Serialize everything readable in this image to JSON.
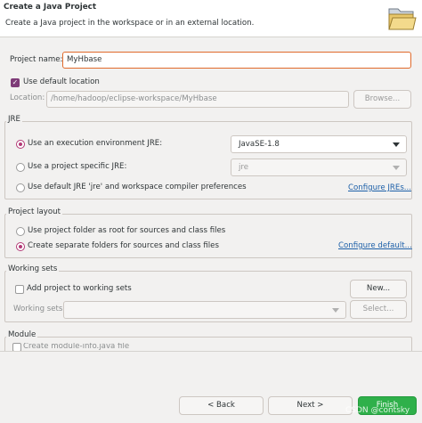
{
  "header": {
    "title": "Create a Java Project",
    "subtitle": "Create a Java project in the workspace or in an external location.",
    "icon": "folder-icon"
  },
  "project": {
    "name_label": "Project name:",
    "name_value": "MyHbase",
    "use_default_label": "Use default location",
    "use_default_checked": true,
    "location_label": "Location:",
    "location_value": "/home/hadoop/eclipse-workspace/MyHbase",
    "browse_label": "Browse..."
  },
  "jre": {
    "group_label": "JRE",
    "opt_env_label": "Use an execution environment JRE:",
    "opt_env_selected": true,
    "env_value": "JavaSE-1.8",
    "opt_specific_label": "Use a project specific JRE:",
    "specific_value": "jre",
    "opt_default_label": "Use default JRE 'jre' and workspace compiler preferences",
    "configure_link": "Configure JREs..."
  },
  "layout": {
    "group_label": "Project layout",
    "opt_root_label": "Use project folder as root for sources and class files",
    "opt_separate_label": "Create separate folders for sources and class files",
    "opt_separate_selected": true,
    "configure_link": "Configure default..."
  },
  "working_sets": {
    "group_label": "Working sets",
    "add_label": "Add project to working sets",
    "add_checked": false,
    "new_label": "New...",
    "sets_label": "Working sets:",
    "select_label": "Select..."
  },
  "module": {
    "group_label": "Module",
    "create_label": "Create module-info.java file"
  },
  "footer": {
    "back_label": "< Back",
    "next_label": "Next >",
    "finish_label": "Finish",
    "watermark": "CSDN @contsky"
  }
}
